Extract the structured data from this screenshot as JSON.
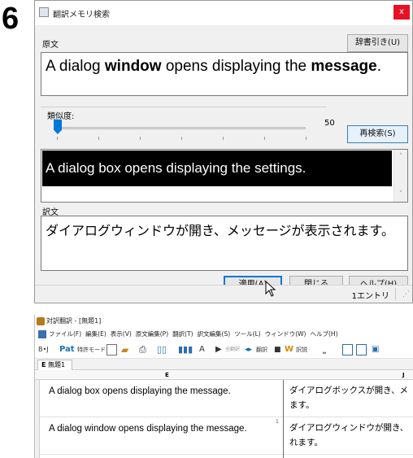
{
  "step_number": "6",
  "dialog": {
    "title": "翻訳メモリ検索",
    "close_label": "x",
    "source_label": "原文",
    "dictionary_button": "辞書引き(U)",
    "source_text": {
      "p1": "A dialog ",
      "b1": "window",
      "p2": " opens displaying the ",
      "b2": "message",
      "p3": "."
    },
    "similarity_label": "類似度:",
    "similarity_value": "50",
    "similarity_level_percent": 50,
    "research_button": "再検索(S)",
    "match_text": "A dialog box opens displaying the settings.",
    "target_label": "訳文",
    "target_text": "ダイアログウィンドウが開き、メッセージが表示されます。",
    "apply_button": "適用(A)",
    "close_button": "閉じる",
    "help_button": "ヘルプ(H)",
    "status_count": "1エントリ"
  },
  "app": {
    "title": "対訳翻訳 - [無題1]",
    "menu": [
      "ファイル(F)",
      "編集(E)",
      "表示(V)",
      "原文編集(P)",
      "翻訳(T)",
      "訳文編集(S)",
      "ツール(L)",
      "ウィンドウ(W)",
      "ヘルプ(H)"
    ],
    "toolbar": {
      "dict_label": "B•J",
      "mode_label": "特許モード",
      "translate_all": "全翻訳",
      "translate": "翻訳",
      "translate_here": "訳説"
    },
    "tab": "無題1",
    "tab_prefix": "E",
    "col_e": "E",
    "col_j": "J",
    "rows": [
      {
        "en": "A dialog box opens displaying the message.",
        "jp1": "ダイアログボックスが開き、メ",
        "jp2": "ます。",
        "num": ""
      },
      {
        "en": "A dialog window opens displaying the message.",
        "jp1": "ダイアログウィンドウが開き、",
        "jp2": "れます。",
        "num": "1"
      }
    ]
  },
  "colors": {
    "accent": "#0078d7",
    "close_red": "#e81123",
    "highlight_bg": "#000000"
  }
}
